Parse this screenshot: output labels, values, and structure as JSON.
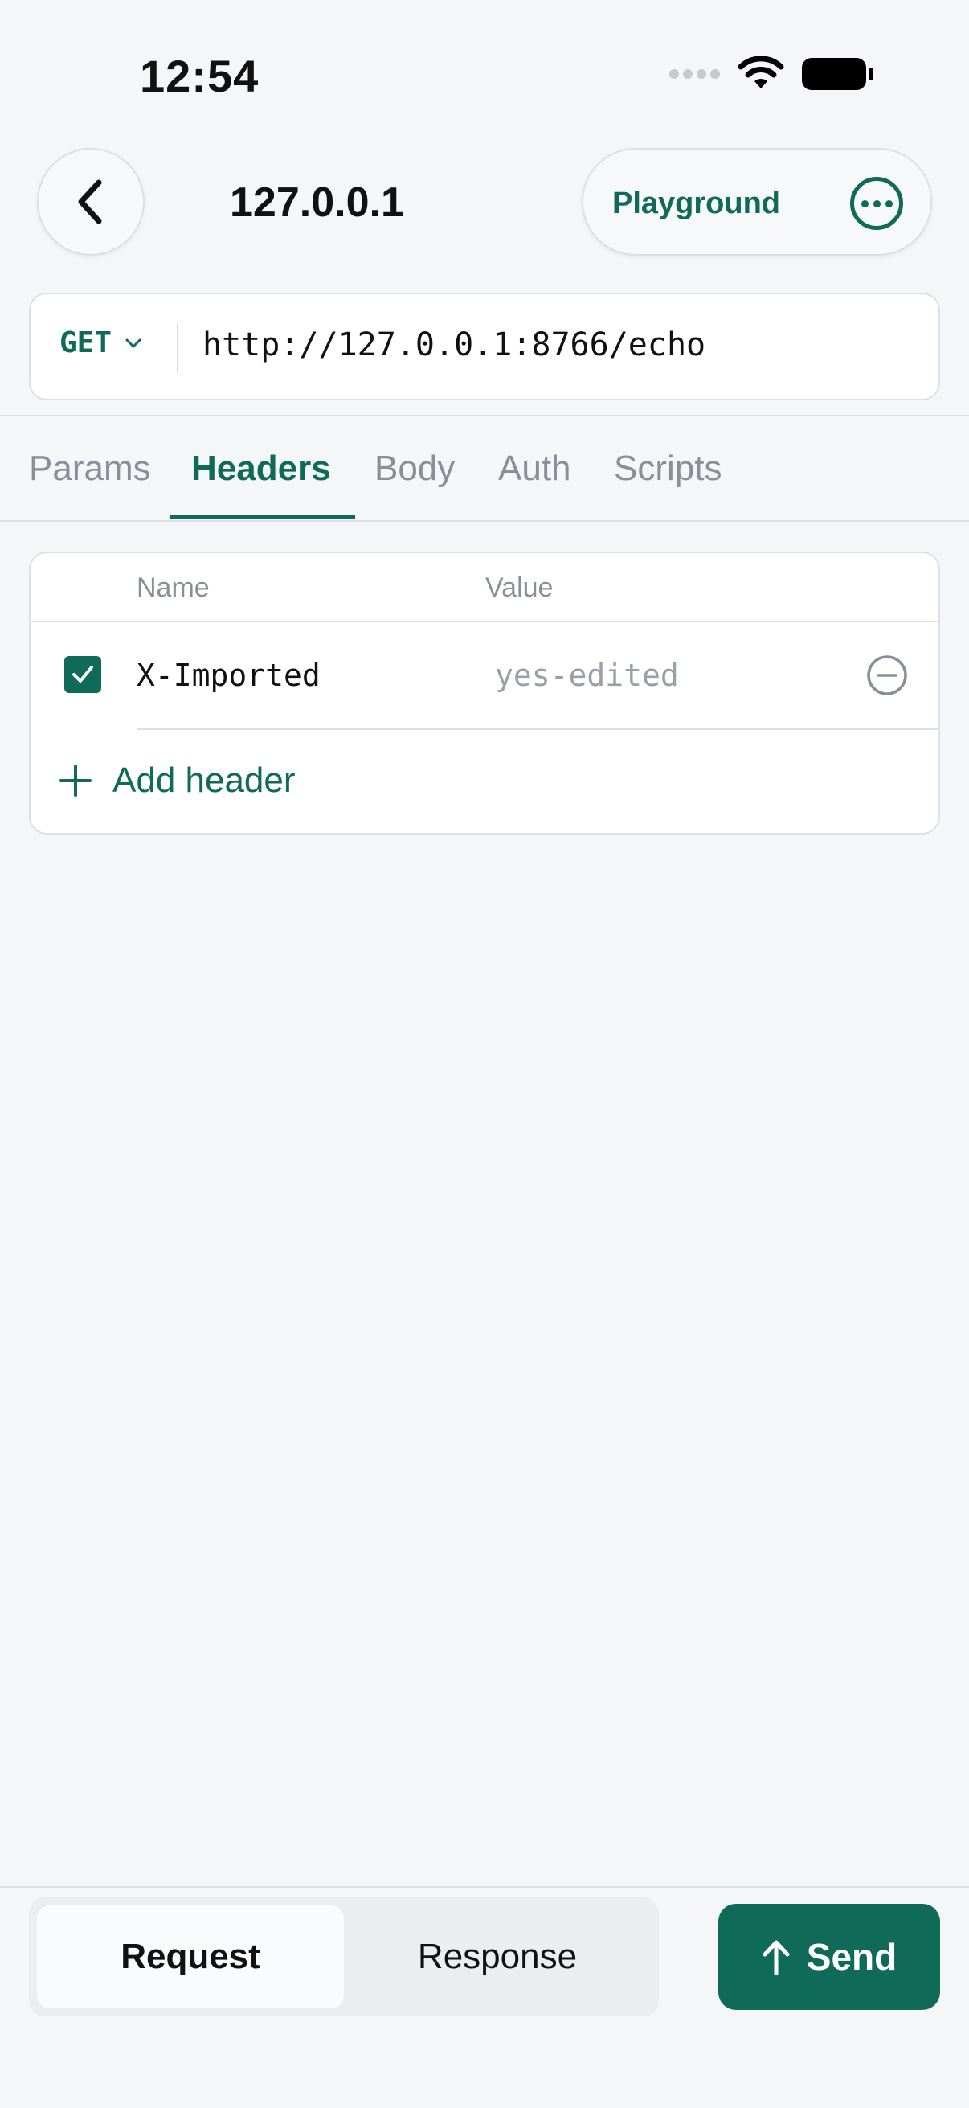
{
  "status_bar": {
    "time": "12:54"
  },
  "nav": {
    "title": "127.0.0.1",
    "playground_label": "Playground"
  },
  "request": {
    "method": "GET",
    "url": "http://127.0.0.1:8766/echo"
  },
  "tabs": [
    {
      "label": "Params",
      "active": false
    },
    {
      "label": "Headers",
      "active": true
    },
    {
      "label": "Body",
      "active": false
    },
    {
      "label": "Auth",
      "active": false
    },
    {
      "label": "Scripts",
      "active": false
    }
  ],
  "headers_table": {
    "columns": {
      "name": "Name",
      "value": "Value"
    },
    "rows": [
      {
        "enabled": true,
        "name": "X-Imported",
        "value": "yes-edited"
      }
    ],
    "add_label": "Add header"
  },
  "bottom": {
    "segments": [
      {
        "label": "Request",
        "selected": true
      },
      {
        "label": "Response",
        "selected": false
      }
    ],
    "send_label": "Send"
  },
  "colors": {
    "accent": "#0f6b57",
    "background": "#f4f6f8",
    "muted_text": "#8a8f96"
  }
}
